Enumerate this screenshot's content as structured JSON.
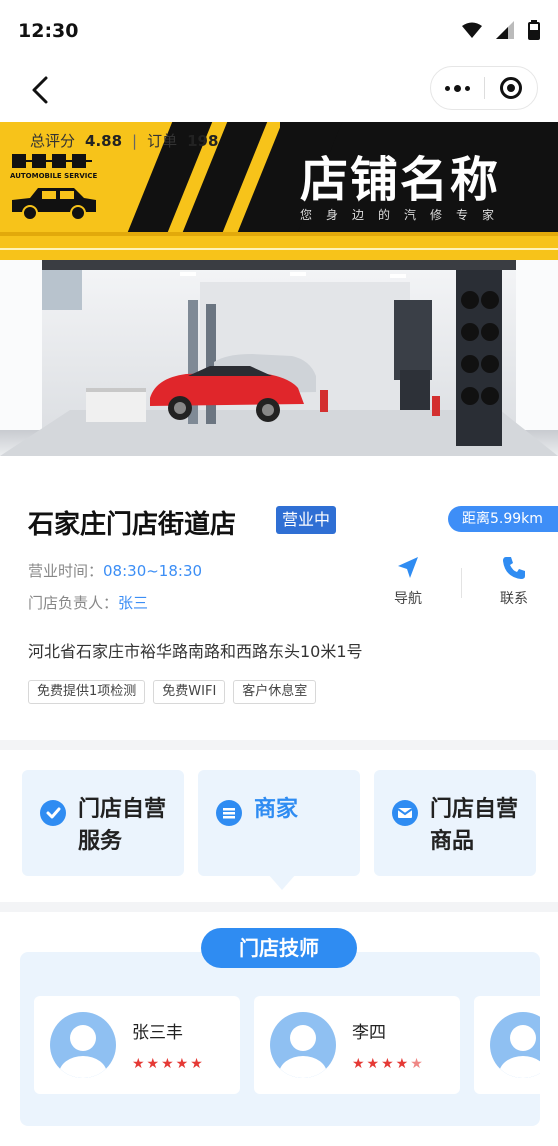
{
  "status_bar": {
    "time": "12:30"
  },
  "nav": {
    "back_icon": "chevron-left-icon",
    "more_icon": "more-dots-icon",
    "close_icon": "target-close-icon"
  },
  "banner": {
    "score_label": "总评分",
    "score_value": "4.88",
    "orders_label": "订单",
    "orders_value": "198",
    "logo_sub": "AUTOMOBILE SERVICE",
    "shop_name": "店铺名称",
    "slogan": "您身边的汽修专家",
    "colors": {
      "yellow": "#f7c31a",
      "black": "#111111"
    }
  },
  "store": {
    "name": "石家庄门店街道店",
    "status_badge": "营业中",
    "distance": "距离5.99km",
    "hours_label": "营业时间：",
    "hours_value": "08:30~18:30",
    "manager_label": "门店负责人：",
    "manager_value": "张三",
    "navigate_label": "导航",
    "contact_label": "联系",
    "address": "河北省石家庄市裕华路南路和西路东头10米1号",
    "tags": [
      "免费提供1项检测",
      "免费WIFI",
      "客户休息室"
    ]
  },
  "categories": [
    {
      "label": "门店自营服务",
      "icon": "check-badge-icon"
    },
    {
      "label": "商家",
      "icon": "list-icon"
    },
    {
      "label": "门店自营商品",
      "icon": "mail-icon"
    }
  ],
  "technicians": {
    "title": "门店技师",
    "items": [
      {
        "name": "张三丰",
        "rating": 5
      },
      {
        "name": "李四",
        "rating": 4.5
      }
    ]
  },
  "accent_color": "#2f8cf2"
}
